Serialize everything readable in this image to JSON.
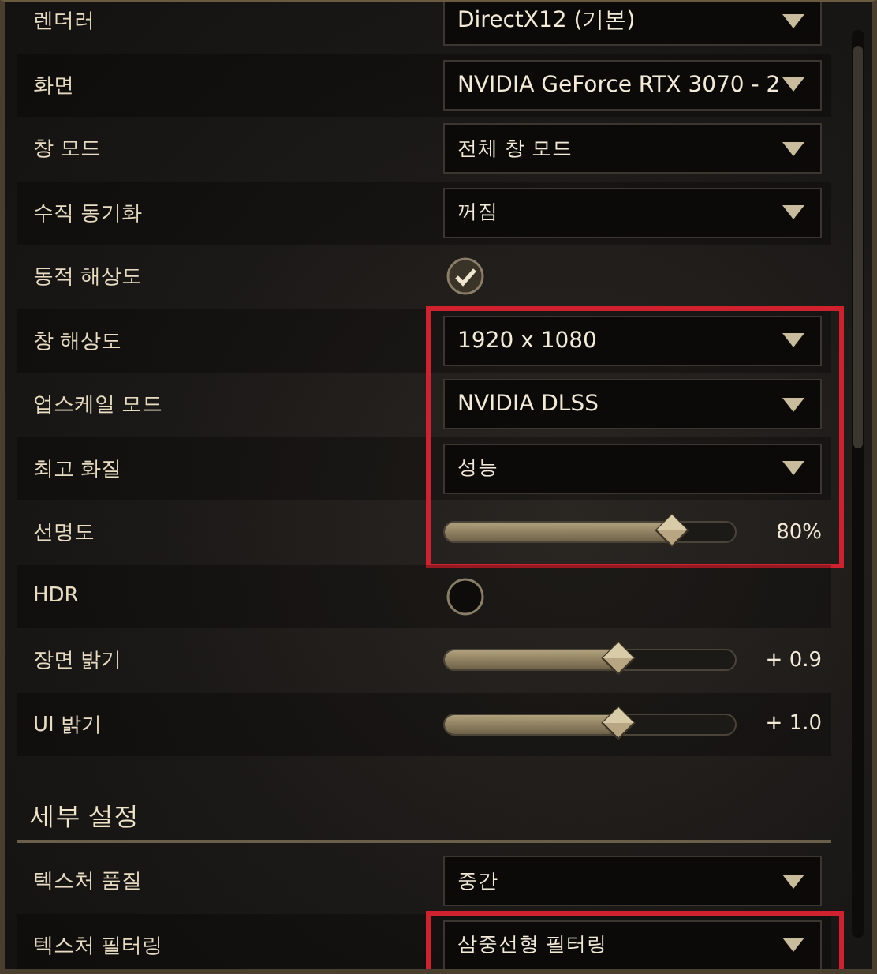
{
  "sections": [
    {
      "rows": [
        {
          "kind": "dropdown",
          "label": "렌더러",
          "value": "DirectX12 (기본)",
          "highlighted": false
        },
        {
          "kind": "dropdown",
          "label": "화면",
          "value": "NVIDIA GeForce RTX 3070 - 2",
          "highlighted": false
        },
        {
          "kind": "dropdown",
          "label": "창 모드",
          "value": "전체 창 모드",
          "highlighted": false
        },
        {
          "kind": "dropdown",
          "label": "수직 동기화",
          "value": "꺼짐",
          "highlighted": false
        },
        {
          "kind": "checkbox",
          "label": "동적 해상도",
          "checked": true,
          "highlighted": false
        },
        {
          "kind": "dropdown",
          "label": "창 해상도",
          "value": "1920 x 1080",
          "highlighted": true
        },
        {
          "kind": "dropdown",
          "label": "업스케일 모드",
          "value": "NVIDIA DLSS",
          "highlighted": true
        },
        {
          "kind": "dropdown",
          "label": "최고 화질",
          "value": "성능",
          "highlighted": true
        },
        {
          "kind": "slider",
          "label": "선명도",
          "level": 0.78,
          "reading": "80%",
          "highlighted": true
        },
        {
          "kind": "checkbox",
          "label": "HDR",
          "checked": false,
          "highlighted": false
        },
        {
          "kind": "slider",
          "label": "장면 밝기",
          "level": 0.6,
          "reading": "+ 0.9",
          "highlighted": false
        },
        {
          "kind": "slider",
          "label": "UI 밝기",
          "level": 0.6,
          "reading": "+ 1.0",
          "highlighted": false
        }
      ]
    },
    {
      "title": "세부 설정",
      "rows": [
        {
          "kind": "dropdown",
          "label": "텍스처 품질",
          "value": "중간",
          "highlighted": false
        },
        {
          "kind": "dropdown",
          "label": "텍스처 필터링",
          "value": "삼중선형 필터링",
          "highlighted": true
        }
      ]
    }
  ]
}
